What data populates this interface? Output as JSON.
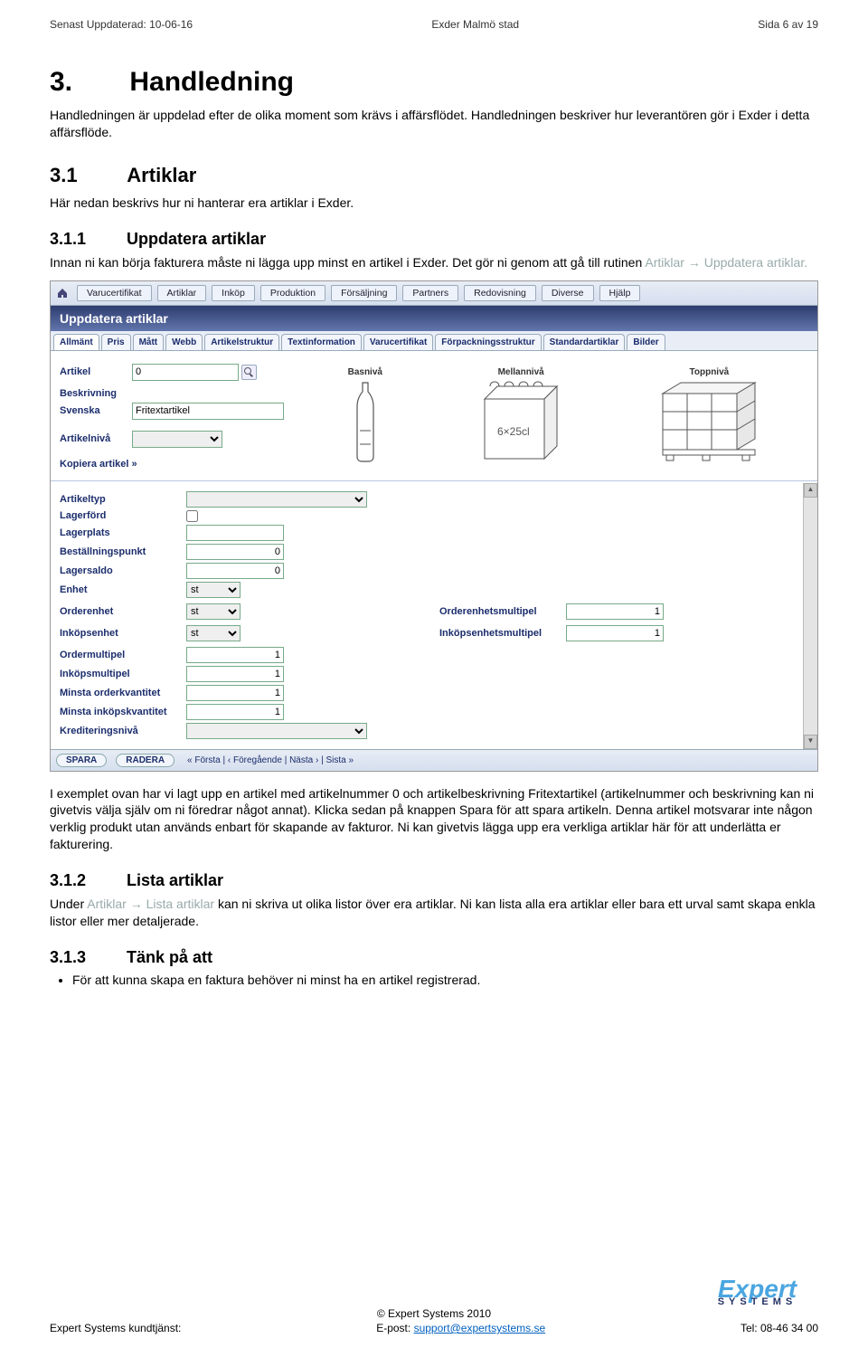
{
  "header": {
    "left": "Senast Uppdaterad: 10-06-16",
    "center": "Exder Malmö stad",
    "right": "Sida 6 av 19"
  },
  "h1": {
    "num": "3.",
    "title": "Handledning"
  },
  "p1": "Handledningen är uppdelad efter de olika moment som krävs i affärsflödet. Handledningen beskriver hur leverantören gör i Exder i detta affärsflöde.",
  "h2a": {
    "num": "3.1",
    "title": "Artiklar"
  },
  "p2": "Här nedan beskrivs hur ni hanterar era artiklar i Exder.",
  "h3a": {
    "num": "3.1.1",
    "title": "Uppdatera artiklar"
  },
  "p3a": "Innan ni kan börja fakturera måste ni lägga upp minst en artikel i Exder. Det gör ni genom att gå till rutinen ",
  "p3b": "Artiklar → Uppdatera artiklar.",
  "shot": {
    "menus": [
      "Varucertifikat",
      "Artiklar",
      "Inköp",
      "Produktion",
      "Försäljning",
      "Partners",
      "Redovisning",
      "Diverse",
      "Hjälp"
    ],
    "title": "Uppdatera artiklar",
    "tabs": [
      "Allmänt",
      "Pris",
      "Mått",
      "Webb",
      "Artikelstruktur",
      "Textinformation",
      "Varucertifikat",
      "Förpackningsstruktur",
      "Standardartiklar",
      "Bilder"
    ],
    "lbl_artikel": "Artikel",
    "val_artikel": "0",
    "lbl_beskr": "Beskrivning",
    "lbl_svenska": "Svenska",
    "val_beskr": "Fritextartikel",
    "lbl_niva": "Artikelnivå",
    "val_niva": "",
    "copy": "Kopiera artikel »",
    "levels": {
      "bas": "Basnivå",
      "mel": "Mellannivå",
      "top": "Toppnivå"
    },
    "fields": {
      "artikeltyp": "Artikeltyp",
      "lagerford": "Lagerförd",
      "lagerplats": "Lagerplats",
      "bestpunkt": "Beställningspunkt",
      "bestpunkt_v": "0",
      "lagersaldo": "Lagersaldo",
      "lagersaldo_v": "0",
      "enhet": "Enhet",
      "enhet_v": "st",
      "orderenhet": "Orderenhet",
      "orderenhet_v": "st",
      "inkopsenhet": "Inköpsenhet",
      "inkopsenhet_v": "st",
      "orderenhetsmultipel": "Orderenhetsmultipel",
      "orderenhetsmultipel_v": "1",
      "inkopsenhetsmultipel": "Inköpsenhetsmultipel",
      "inkopsenhetsmultipel_v": "1",
      "ordermultipel": "Ordermultipel",
      "ordermultipel_v": "1",
      "inkopsmultipel": "Inköpsmultipel",
      "inkopsmultipel_v": "1",
      "minorder": "Minsta orderkvantitet",
      "minorder_v": "1",
      "mininkop": "Minsta inköpskvantitet",
      "mininkop_v": "1",
      "kredit": "Krediteringsnivå",
      "kredit_v": ""
    },
    "foot": {
      "spara": "SPARA",
      "radera": "RADERA",
      "nav": "« Första  |  ‹ Föregående  |  Nästa ›  |  Sista »"
    }
  },
  "p4": "I exemplet ovan har vi lagt upp en artikel med artikelnummer 0 och artikelbeskrivning Fritextartikel (artikelnummer och beskrivning kan ni givetvis välja själv om ni föredrar något annat). Klicka sedan på knappen Spara för att spara artikeln. Denna artikel motsvarar inte någon verklig produkt utan används enbart för skapande av fakturor. Ni kan givetvis lägga upp era verkliga artiklar här för att underlätta er fakturering.",
  "p4_bold": "Spara",
  "h3b": {
    "num": "3.1.2",
    "title": "Lista artiklar"
  },
  "p5a": "Under ",
  "p5gray": "Artiklar → Lista artiklar",
  "p5b": " kan ni skriva ut olika listor över era artiklar. Ni kan lista alla era artiklar eller bara ett urval samt skapa enkla listor eller mer detaljerade.",
  "h3c": {
    "num": "3.1.3",
    "title": "Tänk på att"
  },
  "bullet1": "För att kunna skapa en faktura behöver ni minst ha en artikel registrerad.",
  "footer": {
    "copy": "© Expert Systems 2010",
    "left": "Expert Systems kundtjänst:",
    "mid_lbl": "E-post: ",
    "mid_link": "support@expertsystems.se",
    "right": "Tel: 08-46 34 00",
    "logo_top": "Expert",
    "logo_bottom": "SYSTEMS"
  }
}
